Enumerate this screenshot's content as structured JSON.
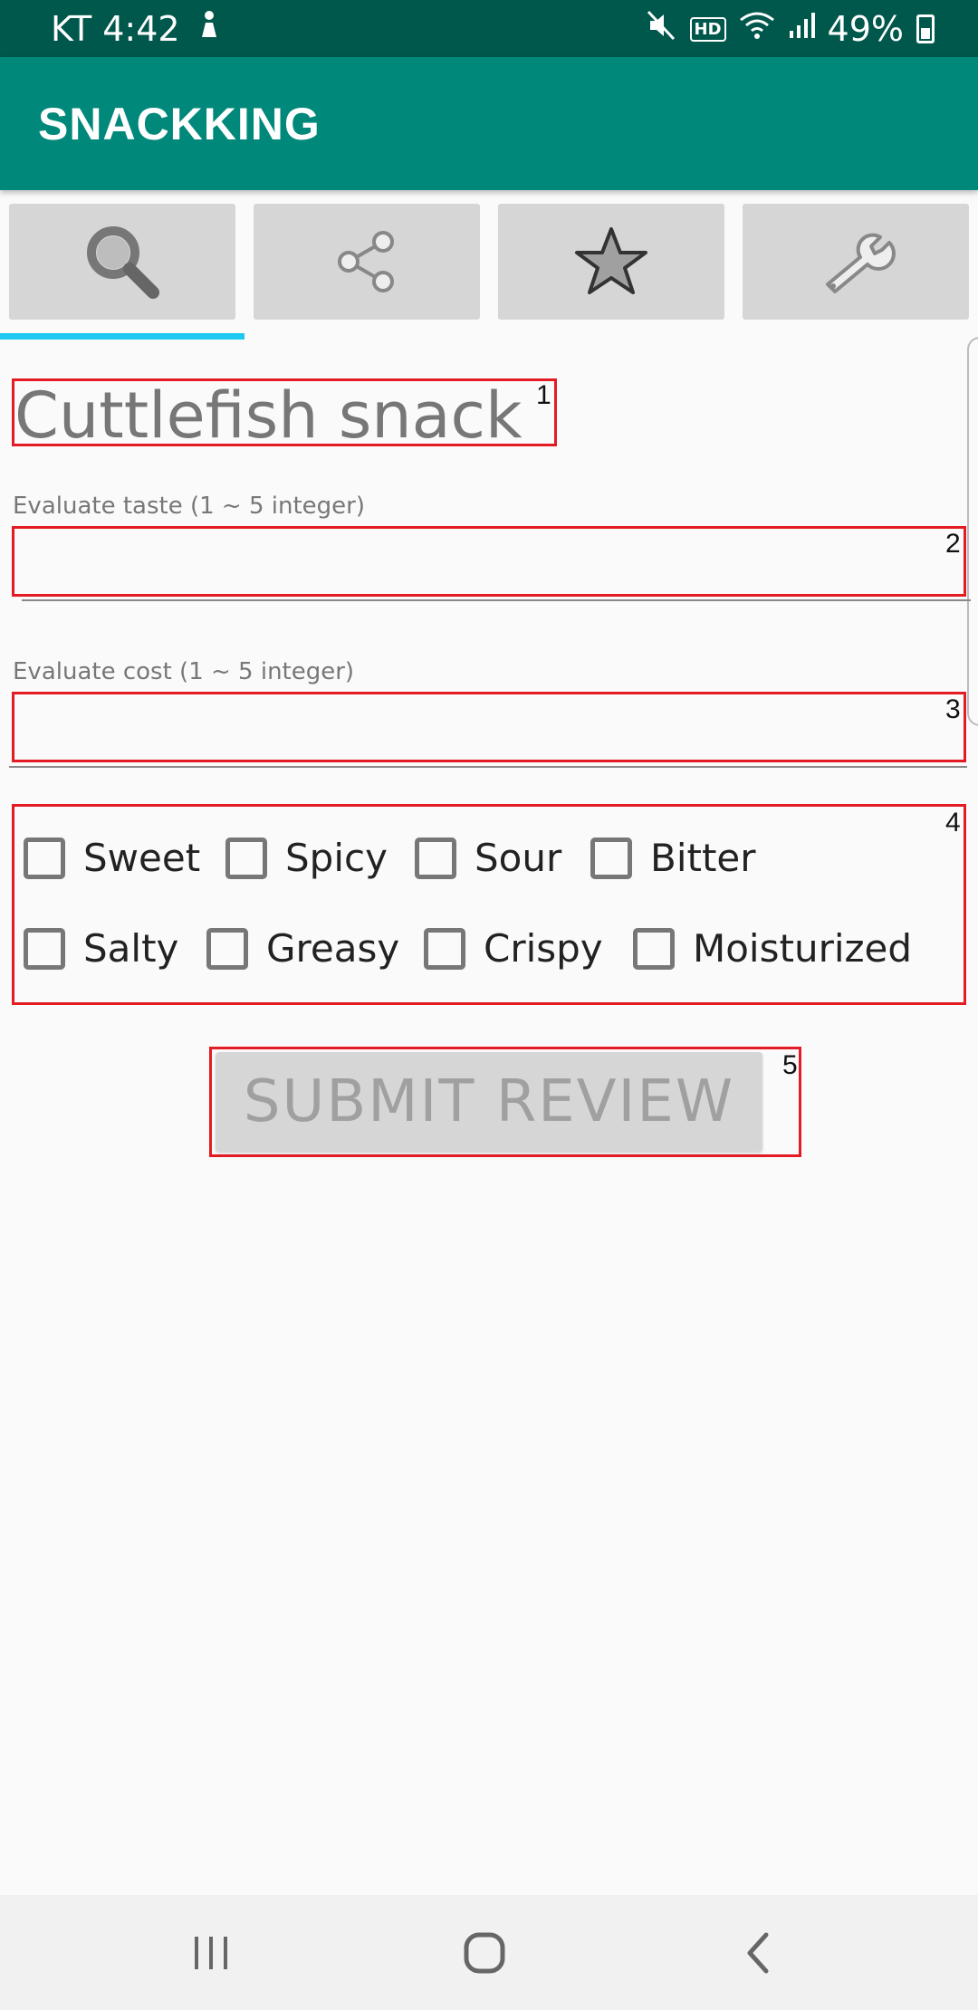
{
  "status_bar": {
    "carrier_time": "KT 4:42",
    "battery": "49%",
    "hd_label": "HD",
    "icons": [
      "notification-figure-icon",
      "mute-icon",
      "hd-voice-icon",
      "wifi-icon",
      "signal-icon",
      "battery-icon"
    ]
  },
  "app_bar": {
    "title": "SNACKKING"
  },
  "tabs": [
    {
      "icon": "search-icon",
      "selected": true
    },
    {
      "icon": "share-icon",
      "selected": false
    },
    {
      "icon": "star-icon",
      "selected": false
    },
    {
      "icon": "wrench-icon",
      "selected": false
    }
  ],
  "snack": {
    "name": "Cuttlefish snack"
  },
  "taste": {
    "label": "Evaluate taste (1 ~ 5 integer)",
    "value": ""
  },
  "cost": {
    "label": "Evaluate cost (1 ~ 5 integer)",
    "value": ""
  },
  "flavors": [
    {
      "label": "Sweet",
      "checked": false
    },
    {
      "label": "Spicy",
      "checked": false
    },
    {
      "label": "Sour",
      "checked": false
    },
    {
      "label": "Bitter",
      "checked": false
    },
    {
      "label": "Salty",
      "checked": false
    },
    {
      "label": "Greasy",
      "checked": false
    },
    {
      "label": "Crispy",
      "checked": false
    },
    {
      "label": "Moisturized",
      "checked": false
    }
  ],
  "submit": {
    "label": "SUBMIT REVIEW"
  },
  "annotations": [
    "1",
    "2",
    "3",
    "4",
    "5"
  ],
  "colors": {
    "app_bar": "#00897b",
    "status_bar": "#00574b",
    "tab_indicator": "#1ec8f0",
    "annotation": "#e31c23"
  },
  "nav": {
    "icons": [
      "recent-apps-icon",
      "home-icon",
      "back-icon"
    ]
  }
}
